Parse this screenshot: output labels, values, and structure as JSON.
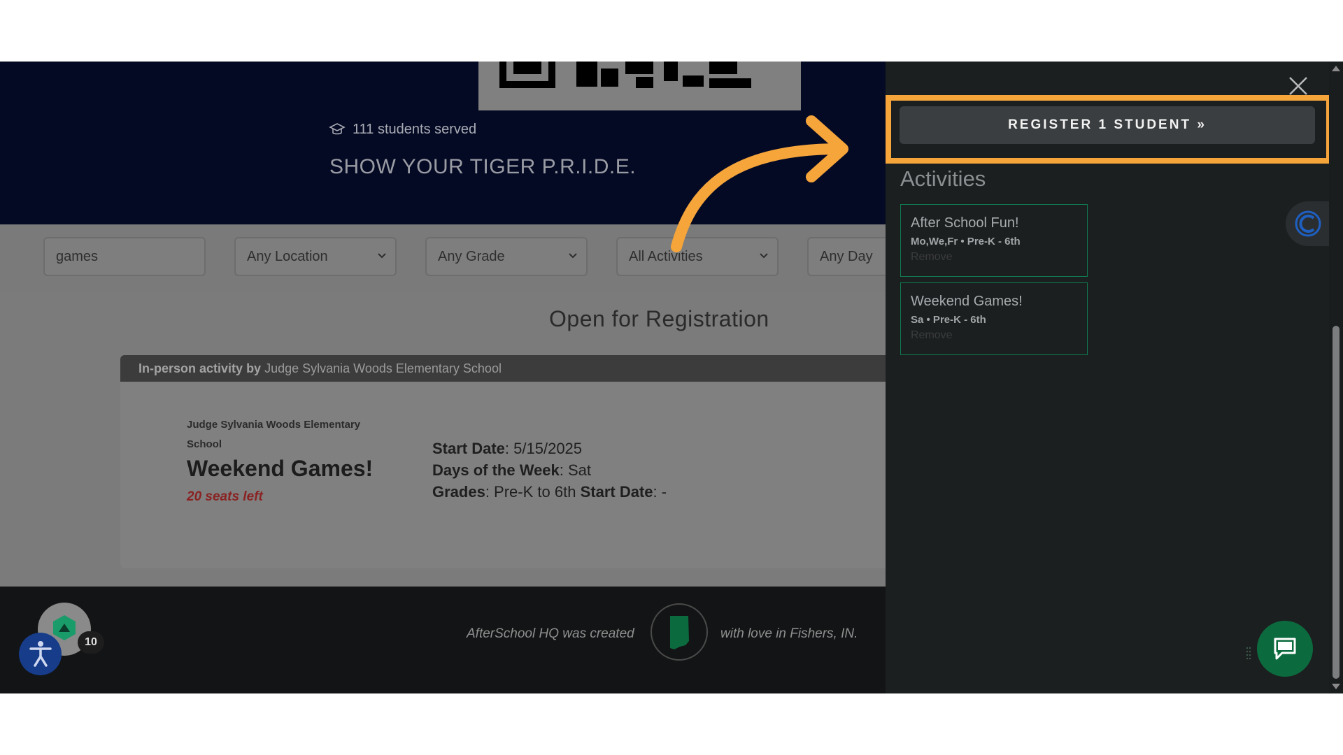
{
  "hero": {
    "students_served": "111 students served",
    "tagline": "SHOW YOUR TIGER P.R.I.D.E."
  },
  "filters": {
    "search_value": "games",
    "location": "Any Location",
    "grade": "Any Grade",
    "activities": "All Activities",
    "day": "Any Day"
  },
  "main": {
    "heading": "Open for Registration"
  },
  "card": {
    "type_label": "In-person activity",
    "by_label": "by",
    "provider": "Judge Sylvania Woods Elementary School",
    "school": "Judge Sylvania Woods Elementary School",
    "title": "Weekend Games!",
    "seats": "20 seats left",
    "start_label": "Start Date",
    "start_value": ": 5/15/2025",
    "days_label": "Days of the Week",
    "days_value": ": Sat",
    "grades_label": "Grades",
    "grades_value": ": Pre-K to 6th",
    "start2_label": "Start Date",
    "start2_value": ": -"
  },
  "footer": {
    "left": "AfterSchool HQ was created",
    "right": "with love in Fishers, IN.",
    "badge_count": "10"
  },
  "drawer": {
    "register_label": "REGISTER 1 STUDENT »",
    "activities_heading": "Activities",
    "items": [
      {
        "title": "After School Fun!",
        "meta": "Mo,We,Fr • Pre-K - 6th",
        "remove": "Remove"
      },
      {
        "title": "Weekend Games!",
        "meta": "Sa • Pre-K - 6th",
        "remove": "Remove"
      }
    ]
  },
  "colors": {
    "highlight": "#f6a53b",
    "hero_bg": "#050a24",
    "accent_green": "#0c6b3e"
  }
}
